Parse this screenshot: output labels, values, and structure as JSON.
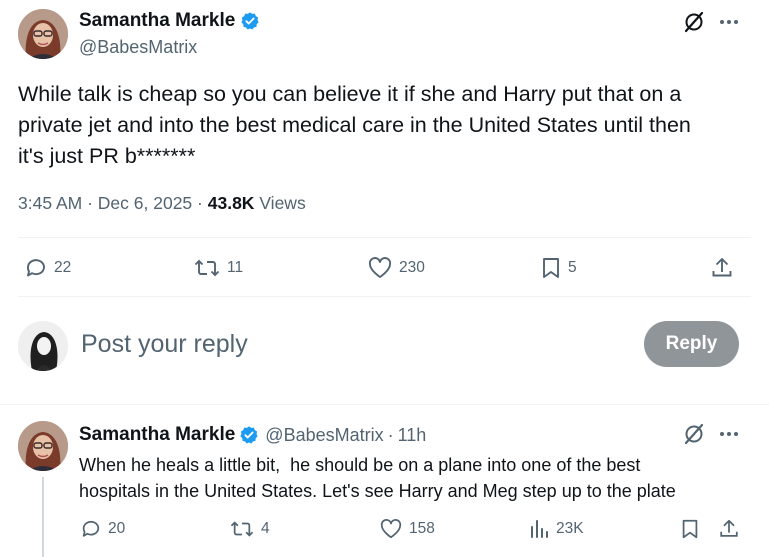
{
  "main_tweet": {
    "author_name": "Samantha Markle",
    "handle": "@BabesMatrix",
    "text_lines": [
      "While talk is cheap so you can believe it if she and Harry put that on a",
      "private jet and into the best medical care in the United States until then",
      "it's just PR b*******"
    ],
    "time": "3:45 AM",
    "date": "Dec 6, 2025",
    "views_count": "43.8K",
    "views_label": "Views",
    "actions": {
      "replies": "22",
      "reposts": "11",
      "likes": "230",
      "bookmarks": "5"
    }
  },
  "reply_composer": {
    "placeholder": "Post your reply",
    "reply_button": "Reply"
  },
  "reply_tweet": {
    "author_name": "Samantha Markle",
    "handle": "@BabesMatrix",
    "separator": "·",
    "age": "11h",
    "text_lines": [
      "When he heals a little bit,  he should be on a plane into one of the best",
      "hospitals in the United States. Let's see Harry and Meg step up to the plate"
    ],
    "actions": {
      "replies": "20",
      "reposts": "4",
      "likes": "158",
      "views": "23K"
    }
  },
  "colors": {
    "verified_blue": "#1d9bf0",
    "text_primary": "#0f1419",
    "text_secondary": "#536471",
    "reply_button_bg": "#8f9599"
  },
  "icons": [
    "verified-badge-icon",
    "grok-icon",
    "more-icon",
    "reply-icon",
    "repost-icon",
    "like-icon",
    "bookmark-icon",
    "share-icon",
    "views-icon"
  ]
}
